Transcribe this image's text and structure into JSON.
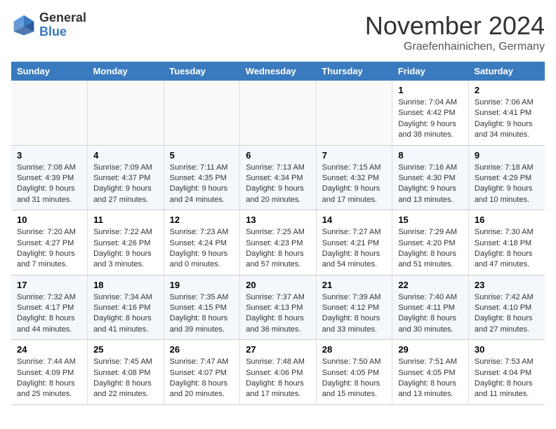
{
  "logo": {
    "general": "General",
    "blue": "Blue"
  },
  "title": "November 2024",
  "location": "Graefenhainichen, Germany",
  "headers": [
    "Sunday",
    "Monday",
    "Tuesday",
    "Wednesday",
    "Thursday",
    "Friday",
    "Saturday"
  ],
  "weeks": [
    [
      {
        "day": "",
        "sunrise": "",
        "sunset": "",
        "daylight": ""
      },
      {
        "day": "",
        "sunrise": "",
        "sunset": "",
        "daylight": ""
      },
      {
        "day": "",
        "sunrise": "",
        "sunset": "",
        "daylight": ""
      },
      {
        "day": "",
        "sunrise": "",
        "sunset": "",
        "daylight": ""
      },
      {
        "day": "",
        "sunrise": "",
        "sunset": "",
        "daylight": ""
      },
      {
        "day": "1",
        "sunrise": "Sunrise: 7:04 AM",
        "sunset": "Sunset: 4:42 PM",
        "daylight": "Daylight: 9 hours and 38 minutes."
      },
      {
        "day": "2",
        "sunrise": "Sunrise: 7:06 AM",
        "sunset": "Sunset: 4:41 PM",
        "daylight": "Daylight: 9 hours and 34 minutes."
      }
    ],
    [
      {
        "day": "3",
        "sunrise": "Sunrise: 7:08 AM",
        "sunset": "Sunset: 4:39 PM",
        "daylight": "Daylight: 9 hours and 31 minutes."
      },
      {
        "day": "4",
        "sunrise": "Sunrise: 7:09 AM",
        "sunset": "Sunset: 4:37 PM",
        "daylight": "Daylight: 9 hours and 27 minutes."
      },
      {
        "day": "5",
        "sunrise": "Sunrise: 7:11 AM",
        "sunset": "Sunset: 4:35 PM",
        "daylight": "Daylight: 9 hours and 24 minutes."
      },
      {
        "day": "6",
        "sunrise": "Sunrise: 7:13 AM",
        "sunset": "Sunset: 4:34 PM",
        "daylight": "Daylight: 9 hours and 20 minutes."
      },
      {
        "day": "7",
        "sunrise": "Sunrise: 7:15 AM",
        "sunset": "Sunset: 4:32 PM",
        "daylight": "Daylight: 9 hours and 17 minutes."
      },
      {
        "day": "8",
        "sunrise": "Sunrise: 7:16 AM",
        "sunset": "Sunset: 4:30 PM",
        "daylight": "Daylight: 9 hours and 13 minutes."
      },
      {
        "day": "9",
        "sunrise": "Sunrise: 7:18 AM",
        "sunset": "Sunset: 4:29 PM",
        "daylight": "Daylight: 9 hours and 10 minutes."
      }
    ],
    [
      {
        "day": "10",
        "sunrise": "Sunrise: 7:20 AM",
        "sunset": "Sunset: 4:27 PM",
        "daylight": "Daylight: 9 hours and 7 minutes."
      },
      {
        "day": "11",
        "sunrise": "Sunrise: 7:22 AM",
        "sunset": "Sunset: 4:26 PM",
        "daylight": "Daylight: 9 hours and 3 minutes."
      },
      {
        "day": "12",
        "sunrise": "Sunrise: 7:23 AM",
        "sunset": "Sunset: 4:24 PM",
        "daylight": "Daylight: 9 hours and 0 minutes."
      },
      {
        "day": "13",
        "sunrise": "Sunrise: 7:25 AM",
        "sunset": "Sunset: 4:23 PM",
        "daylight": "Daylight: 8 hours and 57 minutes."
      },
      {
        "day": "14",
        "sunrise": "Sunrise: 7:27 AM",
        "sunset": "Sunset: 4:21 PM",
        "daylight": "Daylight: 8 hours and 54 minutes."
      },
      {
        "day": "15",
        "sunrise": "Sunrise: 7:29 AM",
        "sunset": "Sunset: 4:20 PM",
        "daylight": "Daylight: 8 hours and 51 minutes."
      },
      {
        "day": "16",
        "sunrise": "Sunrise: 7:30 AM",
        "sunset": "Sunset: 4:18 PM",
        "daylight": "Daylight: 8 hours and 47 minutes."
      }
    ],
    [
      {
        "day": "17",
        "sunrise": "Sunrise: 7:32 AM",
        "sunset": "Sunset: 4:17 PM",
        "daylight": "Daylight: 8 hours and 44 minutes."
      },
      {
        "day": "18",
        "sunrise": "Sunrise: 7:34 AM",
        "sunset": "Sunset: 4:16 PM",
        "daylight": "Daylight: 8 hours and 41 minutes."
      },
      {
        "day": "19",
        "sunrise": "Sunrise: 7:35 AM",
        "sunset": "Sunset: 4:15 PM",
        "daylight": "Daylight: 8 hours and 39 minutes."
      },
      {
        "day": "20",
        "sunrise": "Sunrise: 7:37 AM",
        "sunset": "Sunset: 4:13 PM",
        "daylight": "Daylight: 8 hours and 36 minutes."
      },
      {
        "day": "21",
        "sunrise": "Sunrise: 7:39 AM",
        "sunset": "Sunset: 4:12 PM",
        "daylight": "Daylight: 8 hours and 33 minutes."
      },
      {
        "day": "22",
        "sunrise": "Sunrise: 7:40 AM",
        "sunset": "Sunset: 4:11 PM",
        "daylight": "Daylight: 8 hours and 30 minutes."
      },
      {
        "day": "23",
        "sunrise": "Sunrise: 7:42 AM",
        "sunset": "Sunset: 4:10 PM",
        "daylight": "Daylight: 8 hours and 27 minutes."
      }
    ],
    [
      {
        "day": "24",
        "sunrise": "Sunrise: 7:44 AM",
        "sunset": "Sunset: 4:09 PM",
        "daylight": "Daylight: 8 hours and 25 minutes."
      },
      {
        "day": "25",
        "sunrise": "Sunrise: 7:45 AM",
        "sunset": "Sunset: 4:08 PM",
        "daylight": "Daylight: 8 hours and 22 minutes."
      },
      {
        "day": "26",
        "sunrise": "Sunrise: 7:47 AM",
        "sunset": "Sunset: 4:07 PM",
        "daylight": "Daylight: 8 hours and 20 minutes."
      },
      {
        "day": "27",
        "sunrise": "Sunrise: 7:48 AM",
        "sunset": "Sunset: 4:06 PM",
        "daylight": "Daylight: 8 hours and 17 minutes."
      },
      {
        "day": "28",
        "sunrise": "Sunrise: 7:50 AM",
        "sunset": "Sunset: 4:05 PM",
        "daylight": "Daylight: 8 hours and 15 minutes."
      },
      {
        "day": "29",
        "sunrise": "Sunrise: 7:51 AM",
        "sunset": "Sunset: 4:05 PM",
        "daylight": "Daylight: 8 hours and 13 minutes."
      },
      {
        "day": "30",
        "sunrise": "Sunrise: 7:53 AM",
        "sunset": "Sunset: 4:04 PM",
        "daylight": "Daylight: 8 hours and 11 minutes."
      }
    ]
  ]
}
